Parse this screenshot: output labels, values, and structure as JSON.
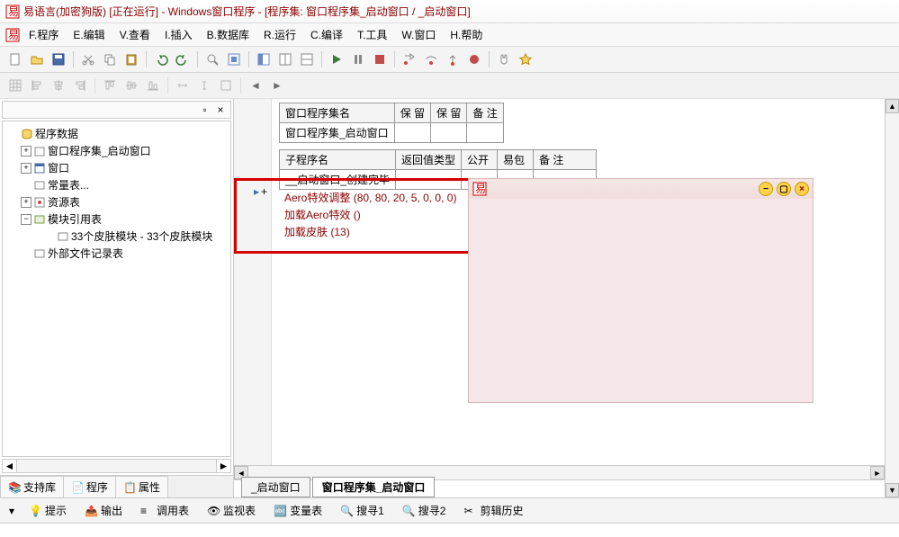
{
  "title": "易语言(加密狗版)  [正在运行] - Windows窗口程序 - [程序集: 窗口程序集_启动窗口 / _启动窗口]",
  "menu": {
    "program": "F.程序",
    "edit": "E.编辑",
    "view": "V.查看",
    "insert": "I.插入",
    "database": "B.数据库",
    "run": "R.运行",
    "compile": "C.编译",
    "tools": "T.工具",
    "window": "W.窗口",
    "help": "H.帮助"
  },
  "tree": {
    "root": "程序数据",
    "wset": "窗口程序集_启动窗口",
    "window": "窗口",
    "const": "常量表...",
    "res": "资源表",
    "modref": "模块引用表",
    "skin": "33个皮肤模块 - 33个皮肤模块",
    "extfile": "外部文件记录表"
  },
  "left_tabs": {
    "support": "支持库",
    "program": "程序",
    "props": "属性"
  },
  "grid1": {
    "h1": "窗口程序集名",
    "h2": "保 留",
    "h3": "保 留",
    "h4": "备 注",
    "r1": "窗口程序集_启动窗口"
  },
  "grid2": {
    "h1": "子程序名",
    "h2": "返回值类型",
    "h3": "公开",
    "h4": "易包",
    "h5": "备 注",
    "r1": "__启动窗口_创建完毕"
  },
  "code": {
    "l1a": "Aero特效调整",
    "l1b": "(80, 80, 20, 5, 0, 0, 0)",
    "l2a": "加载Aero特效",
    "l2b": "()",
    "l3a": "加载皮肤",
    "l3b": "(13)"
  },
  "right_tabs": {
    "t1": "_启动窗口",
    "t2": "窗口程序集_启动窗口"
  },
  "bottom": {
    "hint": "提示",
    "output": "输出",
    "calltable": "调用表",
    "watch": "监视表",
    "vartable": "变量表",
    "search1": "搜寻1",
    "search2": "搜寻2",
    "clip": "剪辑历史"
  }
}
